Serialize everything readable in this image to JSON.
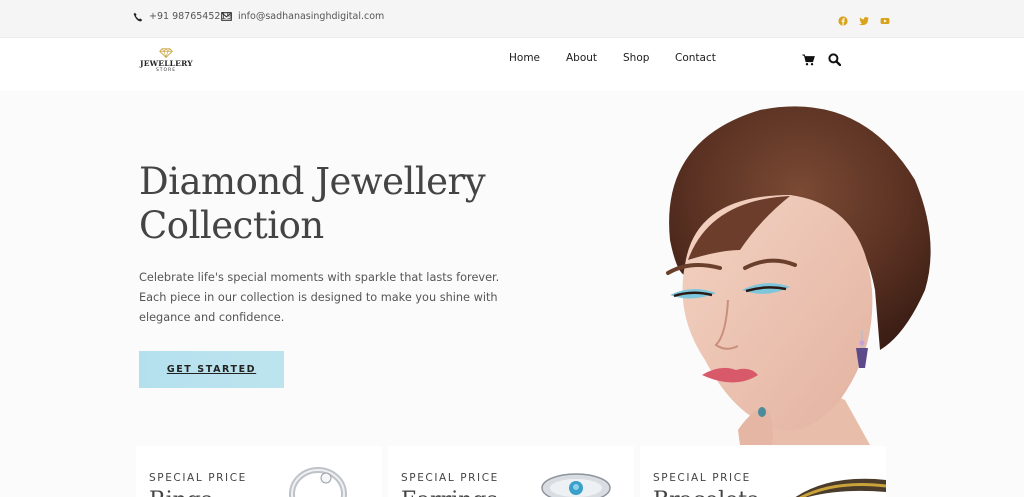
{
  "topbar": {
    "phone": "+91 9876545219",
    "email": "info@sadhanasinghdigital.com",
    "social": [
      "facebook-icon",
      "twitter-icon",
      "youtube-icon"
    ],
    "social_color": "#d9a21b"
  },
  "header": {
    "logo": {
      "line1": "JEWELLERY",
      "line2": "STORE"
    },
    "nav": [
      "Home",
      "About",
      "Shop",
      "Contact"
    ],
    "icons": [
      "cart-icon",
      "search-icon"
    ]
  },
  "hero": {
    "title_line1": "Diamond Jewellery",
    "title_line2": "Collection",
    "description": "Celebrate life's special moments with sparkle that lasts forever. Each piece in our collection is designed to make you shine with elegance and confidence.",
    "cta_label": "GET STARTED",
    "cta_color": "#b5e0ee"
  },
  "cards": [
    {
      "tag": "SPECIAL PRICE",
      "title": "Rings"
    },
    {
      "tag": "SPECIAL PRICE",
      "title": "Earrings"
    },
    {
      "tag": "SPECIAL PRICE",
      "title": "Bracelets"
    }
  ]
}
